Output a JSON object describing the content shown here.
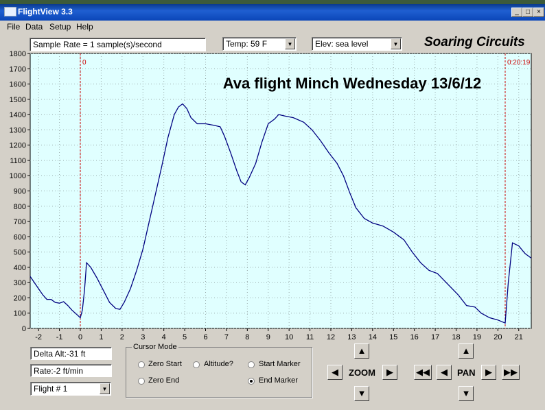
{
  "window": {
    "title": "FlightView 3.3",
    "minimize": "_",
    "maximize": "□",
    "close": "×"
  },
  "menu": [
    "File",
    "Data",
    "Setup",
    "Help"
  ],
  "toolbar": {
    "sample_rate": "Sample Rate =  1 sample(s)/second",
    "temp": "Temp:  59 F",
    "elev": "Elev: sea level",
    "brand": "Soaring Circuits"
  },
  "chart_data": {
    "type": "line",
    "title": "Ava flight Minch Wednesday 13/6/12",
    "xlim": [
      -2.4,
      21.6
    ],
    "ylim": [
      0,
      1800
    ],
    "x_ticks": [
      -2,
      -1,
      0,
      1,
      2,
      3,
      4,
      5,
      6,
      7,
      8,
      9,
      10,
      11,
      12,
      13,
      14,
      15,
      16,
      17,
      18,
      19,
      20,
      21
    ],
    "y_ticks": [
      0,
      100,
      200,
      300,
      400,
      500,
      600,
      700,
      800,
      900,
      1000,
      1100,
      1200,
      1300,
      1400,
      1500,
      1600,
      1700,
      1800
    ],
    "grid": true,
    "background": "#e0ffff",
    "line_color": "#000080",
    "marker_color": "#cc0000",
    "markers": [
      {
        "x": 0,
        "label": "0"
      },
      {
        "x": 20.35,
        "label": "0:20:19"
      }
    ],
    "series": [
      {
        "points": [
          [
            -2.4,
            340
          ],
          [
            -2.1,
            280
          ],
          [
            -1.8,
            220
          ],
          [
            -1.6,
            190
          ],
          [
            -1.4,
            190
          ],
          [
            -1.2,
            170
          ],
          [
            -1.0,
            165
          ],
          [
            -0.8,
            175
          ],
          [
            -0.6,
            150
          ],
          [
            -0.4,
            120
          ],
          [
            -0.2,
            95
          ],
          [
            0.0,
            70
          ],
          [
            0.1,
            120
          ],
          [
            0.2,
            250
          ],
          [
            0.3,
            430
          ],
          [
            0.5,
            400
          ],
          [
            0.8,
            330
          ],
          [
            1.1,
            250
          ],
          [
            1.4,
            170
          ],
          [
            1.7,
            130
          ],
          [
            1.9,
            125
          ],
          [
            2.1,
            170
          ],
          [
            2.4,
            260
          ],
          [
            2.7,
            380
          ],
          [
            3.0,
            520
          ],
          [
            3.3,
            700
          ],
          [
            3.6,
            880
          ],
          [
            3.9,
            1060
          ],
          [
            4.2,
            1250
          ],
          [
            4.5,
            1400
          ],
          [
            4.7,
            1450
          ],
          [
            4.9,
            1470
          ],
          [
            5.1,
            1440
          ],
          [
            5.3,
            1380
          ],
          [
            5.6,
            1340
          ],
          [
            6.0,
            1340
          ],
          [
            6.4,
            1330
          ],
          [
            6.7,
            1320
          ],
          [
            6.9,
            1260
          ],
          [
            7.2,
            1150
          ],
          [
            7.5,
            1030
          ],
          [
            7.7,
            960
          ],
          [
            7.9,
            940
          ],
          [
            8.1,
            990
          ],
          [
            8.4,
            1080
          ],
          [
            8.7,
            1220
          ],
          [
            9.0,
            1340
          ],
          [
            9.3,
            1370
          ],
          [
            9.5,
            1400
          ],
          [
            9.8,
            1390
          ],
          [
            10.2,
            1380
          ],
          [
            10.7,
            1350
          ],
          [
            11.1,
            1300
          ],
          [
            11.5,
            1230
          ],
          [
            11.9,
            1150
          ],
          [
            12.3,
            1080
          ],
          [
            12.6,
            1000
          ],
          [
            12.9,
            890
          ],
          [
            13.2,
            790
          ],
          [
            13.6,
            720
          ],
          [
            14.0,
            690
          ],
          [
            14.5,
            670
          ],
          [
            15.0,
            630
          ],
          [
            15.5,
            580
          ],
          [
            15.9,
            500
          ],
          [
            16.3,
            430
          ],
          [
            16.7,
            380
          ],
          [
            17.1,
            360
          ],
          [
            17.6,
            290
          ],
          [
            18.1,
            220
          ],
          [
            18.5,
            150
          ],
          [
            18.9,
            140
          ],
          [
            19.2,
            100
          ],
          [
            19.6,
            70
          ],
          [
            20.0,
            55
          ],
          [
            20.35,
            35
          ],
          [
            20.5,
            300
          ],
          [
            20.7,
            560
          ],
          [
            21.0,
            540
          ],
          [
            21.3,
            490
          ],
          [
            21.6,
            460
          ]
        ]
      }
    ]
  },
  "stats": {
    "delta_alt": "Delta Alt:-31 ft",
    "rate": "Rate:-2 ft/min",
    "flight": "Flight # 1"
  },
  "cursor_mode": {
    "legend": "Cursor Mode",
    "options": [
      {
        "label": "Zero Start",
        "checked": false
      },
      {
        "label": "Altitude?",
        "checked": false
      },
      {
        "label": "Start Marker",
        "checked": false
      },
      {
        "label": "Zero End",
        "checked": false
      },
      {
        "label": "End Marker",
        "checked": true
      }
    ]
  },
  "nav": {
    "zoom": "ZOOM",
    "pan": "PAN"
  }
}
